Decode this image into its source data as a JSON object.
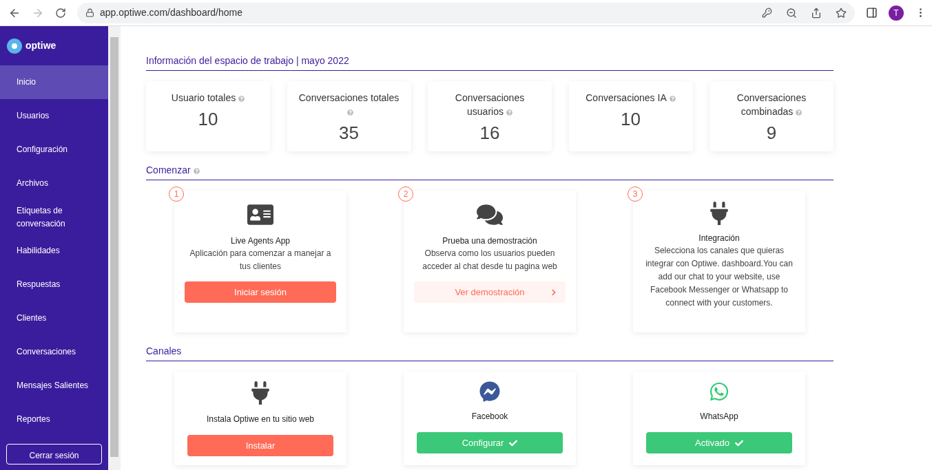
{
  "browser": {
    "url": "app.optiwe.com/dashboard/home",
    "profile_initial": "T"
  },
  "sidebar": {
    "logo": "optiwe",
    "items": [
      {
        "label": "Inicio",
        "selected": true
      },
      {
        "label": "Usuarios",
        "selected": false
      },
      {
        "label": "Configuración",
        "selected": false
      },
      {
        "label": "Archivos",
        "selected": false
      },
      {
        "label": "Etiquetas de conversación",
        "selected": false
      },
      {
        "label": "Habilidades",
        "selected": false
      },
      {
        "label": "Respuestas",
        "selected": false
      },
      {
        "label": "Clientes",
        "selected": false
      },
      {
        "label": "Conversaciones",
        "selected": false
      },
      {
        "label": "Mensajes Salientes",
        "selected": false
      },
      {
        "label": "Reportes",
        "selected": false
      }
    ],
    "logout": "Cerrar sesión"
  },
  "workspace": {
    "title": "Información del espacio de trabajo | mayo 2022",
    "stats": [
      {
        "label": "Usuario totales",
        "value": "10"
      },
      {
        "label": "Conversaciones totales",
        "value": "35"
      },
      {
        "label": "Conversaciones usuarios",
        "value": "16"
      },
      {
        "label": "Conversaciones IA",
        "value": "10"
      },
      {
        "label": "Conversaciones combinadas",
        "value": "9"
      }
    ]
  },
  "start": {
    "title": "Comenzar",
    "steps": [
      {
        "number": "1",
        "kind": "id-card",
        "title": "Live Agents App",
        "text": "Aplicación para comenzar a manejar a tus clientes",
        "button": {
          "kind": "primary",
          "label": "Iniciar sesión"
        }
      },
      {
        "number": "2",
        "kind": "comments",
        "title": "Prueba una demostración",
        "text": "Observa como los usuarios pueden acceder al chat desde tu pagina web",
        "button": {
          "kind": "soft",
          "label": "Ver demostración"
        }
      },
      {
        "number": "3",
        "kind": "plug",
        "title": "Integración",
        "text": "Selecciona los canales que quieras integrar con Optiwe. dashboard.You can add our chat to your website, use Facebook Messenger or Whatsapp to connect with your customers."
      }
    ]
  },
  "channels": {
    "title": "Canales",
    "items": [
      {
        "kind": "plug",
        "title": "Instala Optiwe en tu sitio web",
        "button": {
          "kind": "primary",
          "label": "Instalar"
        }
      },
      {
        "kind": "messenger",
        "title": "Facebook",
        "button": {
          "kind": "success",
          "label": "Configurar"
        }
      },
      {
        "kind": "whatsapp",
        "title": "WhatsApp",
        "button": {
          "kind": "success",
          "label": "Activado"
        }
      }
    ]
  }
}
